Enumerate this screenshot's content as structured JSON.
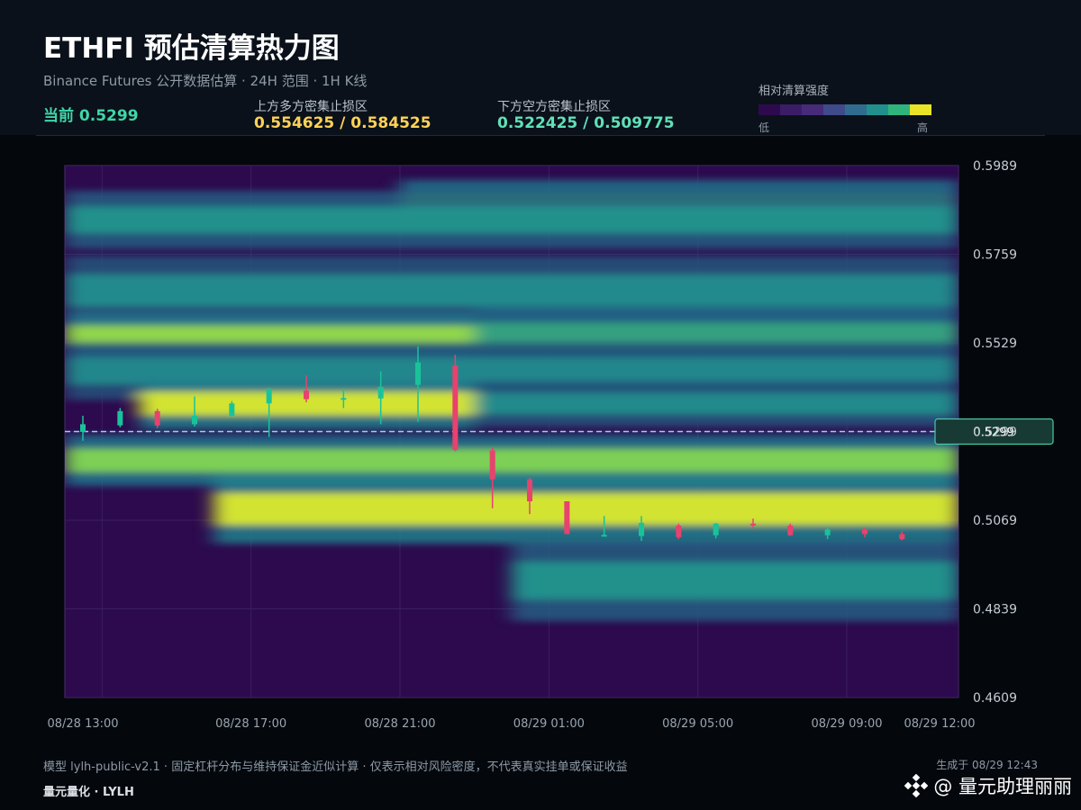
{
  "header": {
    "title": "ETHFI 预估清算热力图",
    "subtitle": "Binance Futures 公开数据估算 · 24H 范围 · 1H K线",
    "current_label": "当前 0.5299",
    "upper_zone_label": "上方多方密集止损区",
    "upper_zone_value": "0.554625 / 0.584525",
    "lower_zone_label": "下方空方密集止损区",
    "lower_zone_value": "0.522425 / 0.509775",
    "legend_title": "相对清算强度",
    "legend_low": "低",
    "legend_high": "高"
  },
  "colors": {
    "background": "#04080d",
    "header_bg": "#0a111a",
    "bullish": "#19c39a",
    "bearish": "#e8426e",
    "current_text": "#3fd6a8",
    "upper_zone_text": "#ffd257",
    "lower_zone_text": "#61e0b8",
    "price_line": "#8fd9e6",
    "price_tag_bg": "#173a34",
    "price_tag_border": "#49c9a7",
    "legend_scale": [
      "#2d0a4e",
      "#3a1d66",
      "#472b7a",
      "#3f4a8a",
      "#2f6c8e",
      "#21908c",
      "#2fb47c",
      "#e8e526"
    ]
  },
  "chart_data": {
    "type": "heatmap",
    "title": "ETHFI 预估清算热力图",
    "ylim": [
      0.4609,
      0.5989
    ],
    "xlim": [
      "08/28 12:00",
      "08/29 12:00"
    ],
    "y_ticks": [
      "0.5989",
      "0.5759",
      "0.5529",
      "0.5299",
      "0.5069",
      "0.4839",
      "0.4609"
    ],
    "x_ticks": [
      "08/28 13:00",
      "08/28 17:00",
      "08/28 21:00",
      "08/29 01:00",
      "08/29 05:00",
      "08/29 09:00",
      "08/29 12:00"
    ],
    "current_price": 0.5299,
    "current_price_label": "0.5299",
    "candles": [
      {
        "t": "08/28 12:00",
        "o": 0.5298,
        "h": 0.534,
        "l": 0.5275,
        "c": 0.5318
      },
      {
        "t": "08/28 13:00",
        "o": 0.5315,
        "h": 0.536,
        "l": 0.531,
        "c": 0.5352
      },
      {
        "t": "08/28 14:00",
        "o": 0.5352,
        "h": 0.5358,
        "l": 0.5308,
        "c": 0.5315
      },
      {
        "t": "08/28 15:00",
        "o": 0.5318,
        "h": 0.539,
        "l": 0.5312,
        "c": 0.534
      },
      {
        "t": "08/28 16:00",
        "o": 0.534,
        "h": 0.5378,
        "l": 0.5335,
        "c": 0.5372
      },
      {
        "t": "08/28 17:00",
        "o": 0.5372,
        "h": 0.5412,
        "l": 0.5285,
        "c": 0.5408
      },
      {
        "t": "08/28 18:00",
        "o": 0.5405,
        "h": 0.5445,
        "l": 0.5375,
        "c": 0.5383
      },
      {
        "t": "08/28 19:00",
        "o": 0.5384,
        "h": 0.541,
        "l": 0.536,
        "c": 0.5386
      },
      {
        "t": "08/28 20:00",
        "o": 0.5385,
        "h": 0.5455,
        "l": 0.5318,
        "c": 0.5415
      },
      {
        "t": "08/28 21:00",
        "o": 0.542,
        "h": 0.552,
        "l": 0.5324,
        "c": 0.5478
      },
      {
        "t": "08/28 22:00",
        "o": 0.547,
        "h": 0.5498,
        "l": 0.5248,
        "c": 0.5251
      },
      {
        "t": "08/28 23:00",
        "o": 0.525,
        "h": 0.5258,
        "l": 0.51,
        "c": 0.5175
      },
      {
        "t": "08/29 00:00",
        "o": 0.5175,
        "h": 0.518,
        "l": 0.5085,
        "c": 0.5118
      },
      {
        "t": "08/29 01:00",
        "o": 0.5118,
        "h": 0.5118,
        "l": 0.5041,
        "c": 0.5033
      },
      {
        "t": "08/29 02:00",
        "o": 0.503,
        "h": 0.508,
        "l": 0.503,
        "c": 0.5031
      },
      {
        "t": "08/29 03:00",
        "o": 0.5028,
        "h": 0.508,
        "l": 0.5015,
        "c": 0.5062
      },
      {
        "t": "08/29 04:00",
        "o": 0.5055,
        "h": 0.506,
        "l": 0.502,
        "c": 0.5025
      },
      {
        "t": "08/29 05:00",
        "o": 0.503,
        "h": 0.5062,
        "l": 0.5022,
        "c": 0.506
      },
      {
        "t": "08/29 06:00",
        "o": 0.506,
        "h": 0.5073,
        "l": 0.5048,
        "c": 0.5056
      },
      {
        "t": "08/29 07:00",
        "o": 0.5055,
        "h": 0.506,
        "l": 0.5028,
        "c": 0.503
      },
      {
        "t": "08/29 08:00",
        "o": 0.503,
        "h": 0.5053,
        "l": 0.502,
        "c": 0.5045
      },
      {
        "t": "08/29 09:00",
        "o": 0.5045,
        "h": 0.505,
        "l": 0.5025,
        "c": 0.5033
      },
      {
        "t": "08/29 10:00",
        "o": 0.5033,
        "h": 0.504,
        "l": 0.5017,
        "c": 0.502
      }
    ],
    "heat_bands": [
      {
        "price": 0.5892,
        "t_start": "08/28 21:00",
        "t_end": "08/29 12:00",
        "intensity": 0.72,
        "spread": 0.002
      },
      {
        "price": 0.5848,
        "t_start": "08/28 12:00",
        "t_end": "08/29 12:00",
        "intensity": 0.55,
        "spread": 0.0025
      },
      {
        "price": 0.5665,
        "t_start": "08/28 12:00",
        "t_end": "08/29 12:00",
        "intensity": 0.5,
        "spread": 0.003
      },
      {
        "price": 0.5546,
        "t_start": "08/28 12:00",
        "t_end": "08/28 23:00",
        "intensity": 0.82,
        "spread": 0.002
      },
      {
        "price": 0.5546,
        "t_start": "08/28 23:00",
        "t_end": "08/29 12:00",
        "intensity": 0.6,
        "spread": 0.0025
      },
      {
        "price": 0.5456,
        "t_start": "08/28 12:00",
        "t_end": "08/29 12:00",
        "intensity": 0.48,
        "spread": 0.0025
      },
      {
        "price": 0.5371,
        "t_start": "08/28 14:00",
        "t_end": "08/28 23:00",
        "intensity": 0.95,
        "spread": 0.0022
      },
      {
        "price": 0.5371,
        "t_start": "08/28 23:00",
        "t_end": "08/29 12:00",
        "intensity": 0.5,
        "spread": 0.002
      },
      {
        "price": 0.5224,
        "t_start": "08/28 12:00",
        "t_end": "08/29 12:00",
        "intensity": 0.78,
        "spread": 0.0022
      },
      {
        "price": 0.5098,
        "t_start": "08/28 16:00",
        "t_end": "08/29 12:00",
        "intensity": 0.95,
        "spread": 0.003
      },
      {
        "price": 0.4912,
        "t_start": "08/29 00:00",
        "t_end": "08/29 12:00",
        "intensity": 0.55,
        "spread": 0.0035
      }
    ]
  },
  "footer": {
    "note": "模型 lylh-public-v2.1 · 固定杠杆分布与维持保证金近似计算 · 仅表示相对风险密度，不代表真实挂单或保证收益",
    "brand": "量元量化 · LYLH",
    "generated": "生成于 08/29 12:43",
    "watermark_text": "@ 量元助理丽丽"
  }
}
